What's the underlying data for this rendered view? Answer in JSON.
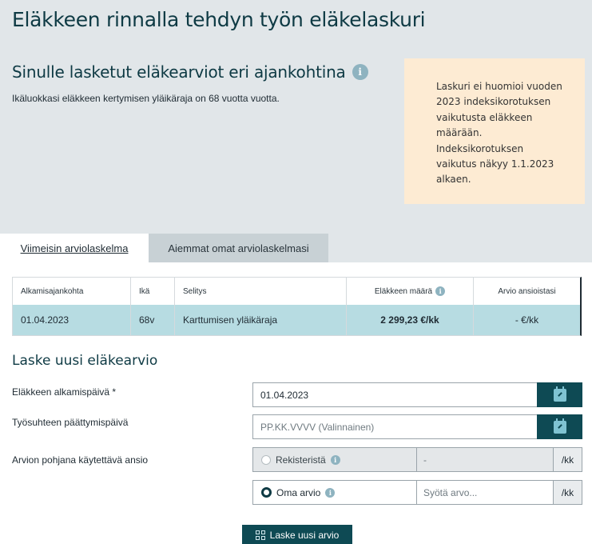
{
  "header": {
    "page_title": "Eläkkeen rinnalla tehdyn työn eläkelaskuri",
    "section_title": "Sinulle lasketut eläkearviot eri ajankohtina",
    "subtitle": "Ikäluokkasi eläkkeen kertymisen yläikäraja on 68 vuotta vuotta."
  },
  "notice": {
    "lines": [
      "Laskuri ei huomioi vuoden",
      "2023 indeksikorotuksen",
      "vaikutusta eläkkeen",
      "määrään.",
      "Indeksikorotuksen",
      "vaikutus näkyy 1.1.2023",
      "alkaen."
    ]
  },
  "tabs": [
    {
      "label": "Viimeisin arviolaskelma",
      "active": true
    },
    {
      "label": "Aiemmat omat arviolaskelmasi",
      "active": false
    }
  ],
  "results": {
    "columns": [
      "Alkamisajankohta",
      "Ikä",
      "Selitys",
      "Eläkkeen määrä",
      "Arvio ansioistasi"
    ],
    "rows": [
      {
        "start": "01.04.2023",
        "age": "68v",
        "description": "Karttumisen yläikäraja",
        "amount": "2 299,23 €/kk",
        "estimate": "- €/kk"
      }
    ]
  },
  "form": {
    "title": "Laske uusi eläkearvio",
    "start_label": "Eläkkeen alkamispäivä *",
    "start_value": "01.04.2023",
    "end_label": "Työsuhteen päättymispäivä",
    "end_placeholder": "PP.KK.VVVV (Valinnainen)",
    "income_label": "Arvion pohjana käytettävä ansio",
    "option_register": "Rekisteristä",
    "register_value": "-",
    "option_own": "Oma arvio",
    "own_placeholder": "Syötä arvo...",
    "unit": "/kk",
    "submit_label": "Laske uusi arvio"
  },
  "colors": {
    "primary": "#0e4a54",
    "header_bg": "#e1e6e9",
    "notice_bg": "#fdebd3",
    "row_highlight": "#b7dce2"
  }
}
